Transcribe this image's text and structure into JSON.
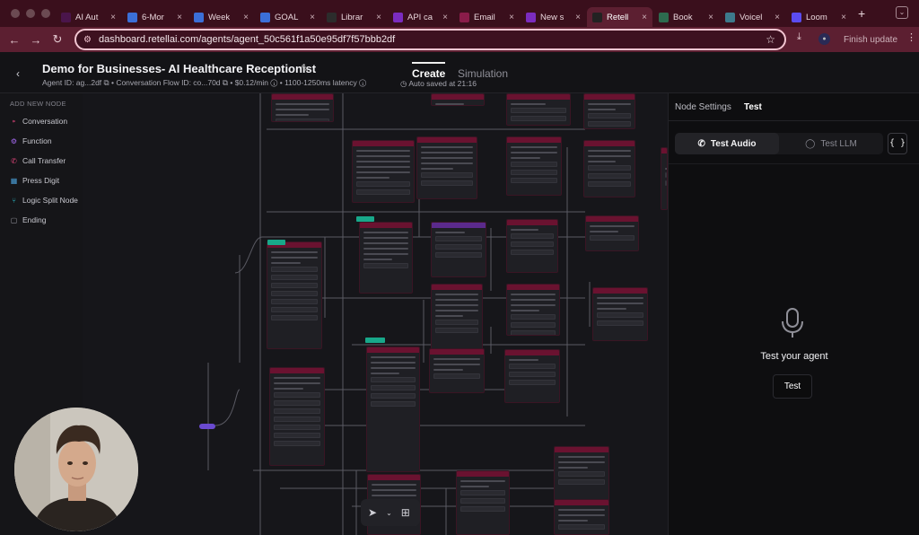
{
  "browser": {
    "tabs": [
      {
        "icon": "slack-icon",
        "label": "AI Aut",
        "color": "#4a154b"
      },
      {
        "icon": "docs-icon",
        "label": "6-Mor",
        "color": "#3b6fd8"
      },
      {
        "icon": "docs-icon",
        "label": "Week",
        "color": "#3b6fd8"
      },
      {
        "icon": "docs-icon",
        "label": "GOAL",
        "color": "#3b6fd8"
      },
      {
        "icon": "library-icon",
        "label": "Librar",
        "color": "#2c2c2c"
      },
      {
        "icon": "make-icon",
        "label": "API ca",
        "color": "#7b2cbf"
      },
      {
        "icon": "retell-icon",
        "label": "Email",
        "color": "#8a1c4a"
      },
      {
        "icon": "make-icon",
        "label": "New s",
        "color": "#7b2cbf"
      },
      {
        "icon": "retell-icon",
        "label": "Retell",
        "color": "#222222",
        "active": true
      },
      {
        "icon": "book-icon",
        "label": "Book",
        "color": "#2d6b4f"
      },
      {
        "icon": "eye-icon",
        "label": "Voicel",
        "color": "#3d7a8c"
      },
      {
        "icon": "loom-icon",
        "label": "Loom",
        "color": "#5b4cf0"
      }
    ],
    "url": "dashboard.retellai.com/agents/agent_50c561f1a50e95df7f57bbb2df",
    "finish_update": "Finish update"
  },
  "header": {
    "title": "Demo for Businesses- AI Healthcare Receptionist",
    "agent_id": "Agent ID: ag...2df",
    "flow_id": "Conversation Flow ID: co...70d",
    "cost": "$0.12/min",
    "latency": "1100-1250ms latency",
    "tabs": {
      "create": "Create",
      "simulation": "Simulation"
    },
    "autosave": "Auto saved at 21:16"
  },
  "sidebar": {
    "heading": "ADD NEW NODE",
    "items": [
      {
        "label": "Conversation",
        "icon": "conversation-icon",
        "glyph": "⁍",
        "color": "#e0457a"
      },
      {
        "label": "Function",
        "icon": "function-icon",
        "glyph": "⚙",
        "color": "#a76bf5"
      },
      {
        "label": "Call Transfer",
        "icon": "phone-icon",
        "glyph": "✆",
        "color": "#e0457a"
      },
      {
        "label": "Press Digit",
        "icon": "keypad-icon",
        "glyph": "▦",
        "color": "#4a9fd8"
      },
      {
        "label": "Logic Split Node",
        "icon": "split-icon",
        "glyph": "⑂",
        "color": "#2ab6c4"
      },
      {
        "label": "Ending",
        "icon": "ending-icon",
        "glyph": "▢",
        "color": "#9a9aa3"
      }
    ]
  },
  "panel": {
    "tabs": {
      "node_settings": "Node Settings",
      "test": "Test"
    },
    "test_audio": "Test Audio",
    "test_llm": "Test LLM",
    "braces": "{ }",
    "prompt": "Test your agent",
    "test_button": "Test"
  },
  "colors": {
    "brand": "#5c1f31",
    "node_header": "#6a1230",
    "chip": "#18a88a",
    "accent_purple": "#6a4ad0"
  }
}
